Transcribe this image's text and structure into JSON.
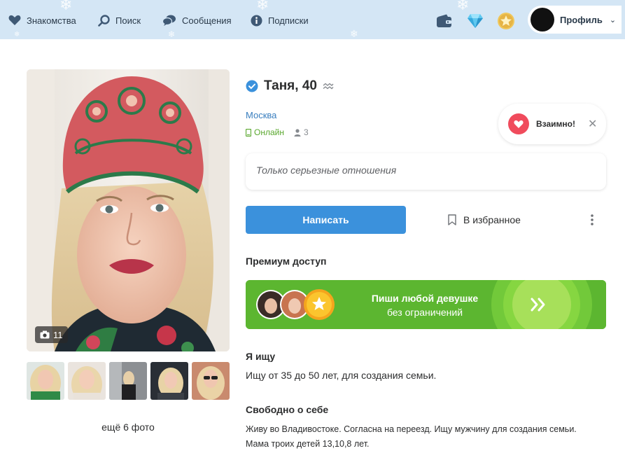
{
  "nav": {
    "items": [
      {
        "label": "Знакомства",
        "icon": "heart-icon"
      },
      {
        "label": "Поиск",
        "icon": "search-icon"
      },
      {
        "label": "Сообщения",
        "icon": "chat-icon"
      },
      {
        "label": "Подписки",
        "icon": "info-icon"
      }
    ],
    "icons": [
      "wallet-icon",
      "diamond-icon",
      "star-icon"
    ],
    "profile_label": "Профиль"
  },
  "profile": {
    "name_age": "Таня, 40",
    "city": "Москва",
    "online_label": "Онлайн",
    "viewers_count": "3",
    "photo_count": "11",
    "more_photos": "ещё 6 фото",
    "intent": "Только серьезные отношения"
  },
  "mutual": {
    "label": "Взаимно!"
  },
  "actions": {
    "write_label": "Написать",
    "favorite_label": "В избранное"
  },
  "premium": {
    "title": "Премиум доступ",
    "line1": "Пиши любой девушке",
    "line2": "без ограничений"
  },
  "looking": {
    "title": "Я ищу",
    "text": "Ищу от 35 до 50 лет, для создания семьи."
  },
  "about": {
    "title": "Свободно о себе",
    "line1": "Живу во Владивостоке. Согласна на переезд. Ищу мужчину для создания семьи.",
    "line2": "Мама троих детей 13,10,8 лет."
  },
  "colors": {
    "accent": "#3b91dc",
    "online": "#5aa82e",
    "premium_green": "#5cb630",
    "mutual_red": "#f04b5c",
    "topbar_bg": "#d4e6f5"
  }
}
